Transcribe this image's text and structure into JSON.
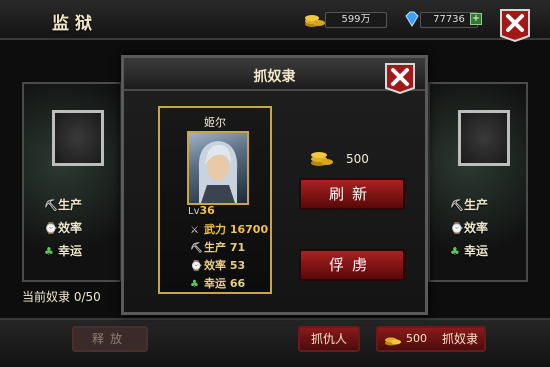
{
  "header": {
    "title": "监狱",
    "gold": "599万",
    "gems": "77736",
    "plus": "+"
  },
  "side_panels": {
    "stats": [
      {
        "icon": "pickaxe-icon",
        "label": "生产"
      },
      {
        "icon": "watch-icon",
        "label": "效率"
      },
      {
        "icon": "clover-icon",
        "label": "幸运"
      }
    ]
  },
  "slave_count": "当前奴隶 0/50",
  "dialog": {
    "title": "抓奴隶",
    "character": {
      "name": "姬尔",
      "level_prefix": "Lv",
      "level": "36",
      "stats": [
        {
          "label": "武力",
          "value": "16700"
        },
        {
          "label": "生产",
          "value": "71"
        },
        {
          "label": "效率",
          "value": "53"
        },
        {
          "label": "幸运",
          "value": "66"
        }
      ]
    },
    "cost": "500",
    "refresh_label": "刷新",
    "capture_label": "俘虏"
  },
  "bottom": {
    "release_label": "释放",
    "enemy_label": "抓仇人",
    "catch_cost": "500",
    "catch_label": "抓奴隶"
  },
  "colors": {
    "accent_red": "#a82222",
    "gold": "#c9a54a"
  }
}
